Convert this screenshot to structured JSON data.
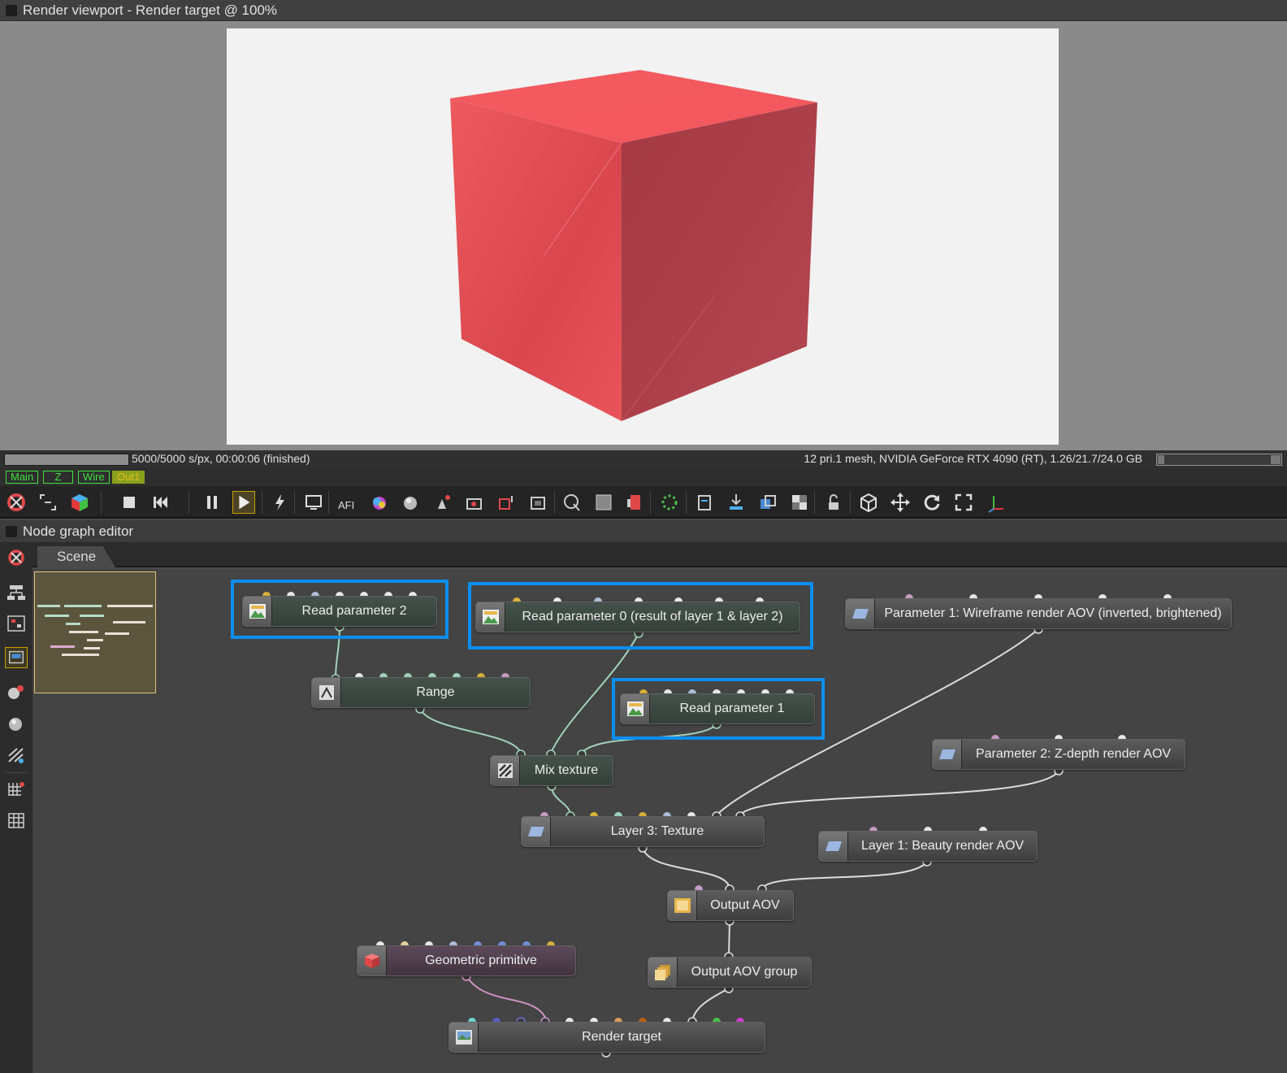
{
  "window_title": "Render viewport - Render target @ 100%",
  "status": {
    "left": "5000/5000 s/px, 00:00:06 (finished)",
    "right": "12 pri.1 mesh, NVIDIA GeForce RTX 4090 (RT), 1.26/21.7/24.0 GB"
  },
  "viewport_tabs": [
    "Main",
    "Z",
    "Wire",
    "Out1"
  ],
  "node_editor": {
    "title": "Node graph editor",
    "scene_tab": "Scene"
  },
  "colors": {
    "highlight": "#0b8ff1",
    "cube": "#e8505a",
    "render_bg": "#f2f2f2"
  },
  "nodes": {
    "read_param_2": "Read parameter 2",
    "read_param_0": "Read parameter 0 (result of layer 1 & layer 2)",
    "param_1": "Parameter 1: Wireframe render AOV (inverted, brightened)",
    "range": "Range",
    "read_param_1": "Read parameter 1",
    "param_2": "Parameter 2: Z-depth render AOV",
    "mix_texture": "Mix texture",
    "layer_3": "Layer 3: Texture",
    "layer_1": "Layer 1: Beauty render AOV",
    "output_aov": "Output AOV",
    "geometric_primitive": "Geometric primitive",
    "output_aov_group": "Output AOV group",
    "render_target": "Render target"
  }
}
